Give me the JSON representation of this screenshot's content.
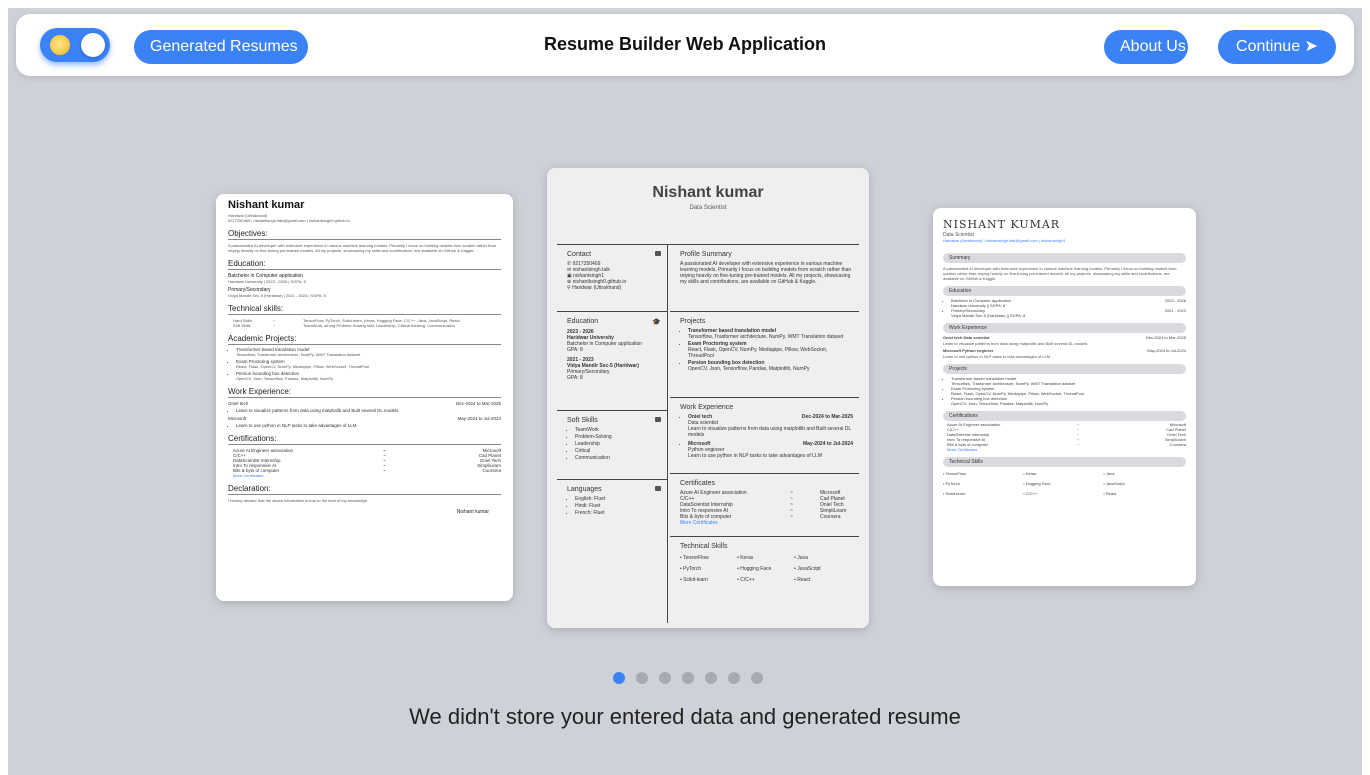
{
  "header": {
    "title": "Resume Builder Web Application",
    "generated_btn": "Generated Resumes",
    "about_btn": "About Us",
    "continue_btn": "Continue ➤"
  },
  "carousel": {
    "slide_count": 7,
    "active_index": 0,
    "message": "We didn't store your entered data and generated resume"
  },
  "resume_left": {
    "name": "Nishant kumar",
    "location": "Haridwar (Uttrakhand)",
    "contact": "9217250469 | nishantsingh.talk@gmail.com | nishantsingh0.github.io",
    "objectives_title": "Objectives:",
    "objectives": "A passionated AI developer with extensive experience in various machine learning models. Primarily I focus on building models from scratch rather than relying heavily on fine-tuning pre-trained models. All my projects, showcasing my skills and contributions, are available on GitHub & Kaggle.",
    "education_title": "Education:",
    "edu1": "Batchelor in Computer application",
    "edu1_detail": "Haridwar University | 2023 - 2026 | SGPA: 8",
    "edu2": "Primary/Secondary",
    "edu2_detail": "Vidya Mandir Sec-5 (Haridwar) | 2021 - 2023 | SGPA: 8",
    "tech_title": "Technical skills:",
    "hard_label": "Hard Skills",
    "hard_val": "TensorFlow, PyTorch, Scikit-learn, Keras, Hugging Face, C/C++, Java, JavaScript, React",
    "soft_label": "Soft Skills",
    "soft_val": "TeamWork, strong Problem-Solving skill, Leadership, Critical thinking, Communication",
    "projects_title": "Academic Projects:",
    "p1": "Transformer based translation model",
    "p1d": "Tensorflow, Trasformer architecture, NumPy, WMT Translation dataset",
    "p2": "Exam Proctoring system",
    "p2d": "React, Flask, OpenCV, NumPy, Mediapipe, Pillow, WebSocket, ThreadPool",
    "p3": "Persion bounding box detection",
    "p3d": "OpenCV, Json, Tensorflow, Pandas, Matplotlib, NumPy",
    "work_title": "Work Experience:",
    "w1": "Oniel tech",
    "w1_date": "Dec-2024 to Mar-2025",
    "w1d": "Learn to visualize patterns from data using matplotlib and Built several DL models",
    "w2": "Microsoft",
    "w2_date": "May-2024 to Jul-2024",
    "w2d": "Learn to use python in NLP tasks to take advantages of LLM",
    "cert_title": "Certifications:",
    "certs": [
      {
        "name": "Azure AI Engineer association",
        "org": "Microsoft"
      },
      {
        "name": "C/C++",
        "org": "Cad Planet"
      },
      {
        "name": "DataScientist Internship",
        "org": "Oniel Tech"
      },
      {
        "name": "Intro To responsive AI",
        "org": "SimpliLearn"
      },
      {
        "name": "Bits & byts of computer",
        "org": "Coursera"
      }
    ],
    "more_certs": "More Certificates",
    "decl_title": "Declaration:",
    "declaration": "I hereby declare that the above information is true to the best of my knowledge.",
    "signature": "Nishant kumar"
  },
  "resume_center": {
    "name": "Nishant kumar",
    "role": "Data Scientist",
    "contact_title": "Contact",
    "phone": "9217250469",
    "email": "nishantsingh.talk",
    "linkedin": "nishantsingh1",
    "web": "nishantksingh0.github.io",
    "location": "Haridwar (Uttrakhand)",
    "edu_title": "Education",
    "e1_years": "2023 - 2026",
    "e1_school": "Haridwar University",
    "e1_degree": "Batchelor in Computer application",
    "e1_gpa": "GPA: 8",
    "e2_years": "2021 - 2023",
    "e2_school": "Vidya Mandir Sec-5 (Haridwar)",
    "e2_degree": "Primary/Secondary",
    "e2_gpa": "GPA: 8",
    "soft_title": "Soft Skills",
    "soft": [
      "TeamWork",
      "Problem-Solving",
      "Leadership",
      "Critical",
      "Communication"
    ],
    "lang_title": "Languages",
    "langs": [
      "English: Fluet",
      "Hindi: Fluet",
      "French: Fluet"
    ],
    "summary_title": "Profile Summary",
    "summary": "A passionated AI developer with extensive experience in various machine learning models, Primarily I focus on building models from scratch rather than relying heavily on fine-tuning pre-trained models. All my projects, showcasing my skills and contributions, are available on GitHub & Kaggle.",
    "projects_title": "Projects",
    "p1": "Transformer based translation model",
    "p1d": "Tensorflow, Trasformer architecture, NumPy, WMT Translation dataset",
    "p2": "Exam Proctoring system",
    "p2d": "React, Flask, OpenCV, NumPy, Mediapipe, Pillow, WebSocket, ThreadPool",
    "p3": "Persion bounding box detection",
    "p3d": "OpenCV, Json, Tensorflow, Pandas, Matplotlib, NumPy",
    "work_title": "Work Experience",
    "w1": "Oniel tech",
    "w1_date": "Dec-2024 to Mar-2025",
    "w1_role": "Data scientist",
    "w1d": "Learn to visualize patterns from data using matplotlib and Built several DL models",
    "w2": "Microsoft",
    "w2_date": "May-2024 to Jul-2024",
    "w2_role": "Python engineer",
    "w2d": "Learn to use python in NLP tasks to take advantages of LLM",
    "cert_title": "Certificates",
    "certs": [
      {
        "name": "Azure AI Engineer association",
        "sep": "~",
        "org": "Microsoft"
      },
      {
        "name": "C/C++",
        "sep": "~",
        "org": "Cad Planet"
      },
      {
        "name": "DataScientist Internship",
        "sep": "~",
        "org": "Oniel Tech"
      },
      {
        "name": "Intro To responsive AI",
        "sep": "~",
        "org": "SimpliLearn"
      },
      {
        "name": "Bits & byts of computer",
        "sep": "~",
        "org": "Coursera"
      }
    ],
    "more_certs": "More Certificates",
    "tech_title": "Technical Skills",
    "skills": [
      "TensorFlow",
      "Keras",
      "Java",
      "PyTorch",
      "Hugging Face",
      "JavaScript",
      "Scikit-learn",
      "C/C++",
      "React"
    ]
  },
  "resume_right": {
    "name": "NISHANT KUMAR",
    "role": "Data Scientist",
    "contact": "Haridwar (Uttrakhand) | nishantsingh.talk@gmail.com | nishantsingh1",
    "summary_title": "Summary",
    "summary": "A passionated AI developer with extensive experience in various machine learning models. Primarily I focus on building models from scratch rather than relying heavily on fine-tuning pre-trained models. All my projects, showcasing my skills and contributions, are available on GitHub & Kaggle.",
    "edu_title": "Education",
    "e1": "Batchelor in Computer application",
    "e1_date": "2023 - 2026",
    "e1d": "Haridwar University || SGPA: 8",
    "e2": "Primary/Secondary",
    "e2_date": "2021 - 2023",
    "e2d": "Vidya Mandir Sec-5 (Haridwar) || SGPA: 8",
    "work_title": "Work Experience",
    "w1": "Oniel tech Data scientist",
    "w1_date": "Dec-2024 to Mar-2025",
    "w1d": "Learn to visualize patterns from data using matplotlib and Built several DL models",
    "w2": "Microsoft Python engineer",
    "w2_date": "May-2024 to Jul-2024",
    "w2d": "Learn to use python in NLP tasks to take advantages of LLM",
    "projects_title": "Projects",
    "p1": "Transformer based translation model",
    "p1d": "Tensorflow, Trasformer architecture, NumPy, WMT Translation dataset",
    "p2": "Exam Proctoring system",
    "p2d": "React, Flask, OpenCV, NumPy, Mediapipe, Pillow, WebSocket, ThreadPool",
    "p3": "Persion bounding box detection",
    "p3d": "OpenCV, Json, Tensorflow, Pandas, Matplotlib, NumPy",
    "cert_title": "Certifications",
    "certs": [
      {
        "name": "Azure AI Engineer association",
        "org": "Microsoft"
      },
      {
        "name": "C/C++",
        "org": "Cad Planet"
      },
      {
        "name": "DataScientist Internship",
        "org": "Oniel Tech"
      },
      {
        "name": "Intro To responsive AI",
        "org": "SimpliLearn"
      },
      {
        "name": "Bits & byts of computer",
        "org": "Coursera"
      }
    ],
    "more_certs": "More Certificates",
    "tech_title": "Technical Skills",
    "skills": [
      "TensorFlow",
      "Keras",
      "Java",
      "PyTorch",
      "Hugging Face",
      "JavaScript",
      "Scikit-learn",
      "C/C++",
      "React"
    ]
  }
}
